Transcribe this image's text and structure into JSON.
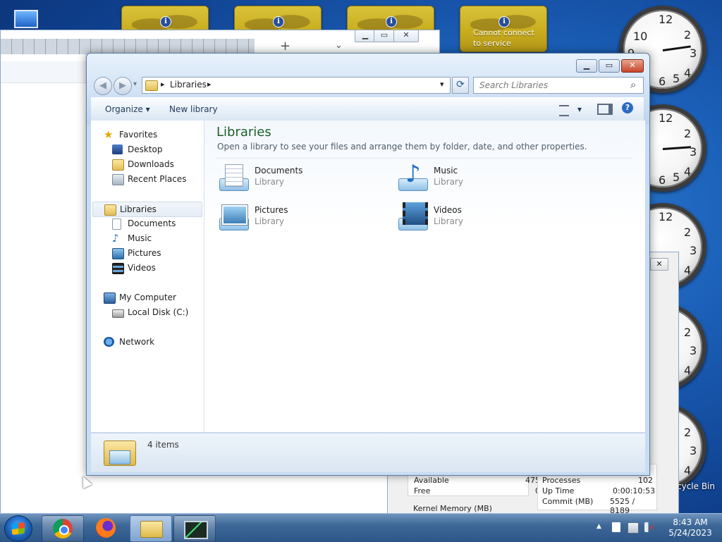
{
  "desktop": {
    "weather_gadgets": [
      {
        "message": ""
      },
      {
        "message": ""
      },
      {
        "message": ""
      },
      {
        "message": "Cannot connect to service"
      }
    ],
    "recycle_bin_label": "cycle Bin",
    "clock_numbers": [
      "12",
      "2",
      "3",
      "4",
      "5",
      "6",
      "9",
      "10"
    ]
  },
  "background_window": {
    "new_tab_symbol": "+",
    "tab_menu_symbol": "⌄"
  },
  "task_manager": {
    "close_symbol": "✕",
    "physical_memory": {
      "available_label": "Available",
      "available_value": "475",
      "free_label": "Free",
      "free_value": "0"
    },
    "kernel_memory_label": "Kernel Memory (MB)",
    "system": {
      "processes_label": "Processes",
      "processes_value": "102",
      "uptime_label": "Up Time",
      "uptime_value": "0:00:10:53",
      "commit_label": "Commit (MB)",
      "commit_value": "5525 / 8189"
    }
  },
  "explorer": {
    "caption_buttons": {
      "minimize": "▁",
      "maximize": "▭",
      "close": "✕"
    },
    "nav": {
      "back": "◀",
      "forward": "▶",
      "dropdown": "▾"
    },
    "address": {
      "crumb": "Libraries",
      "separator": "▸",
      "dropdown": "▾",
      "refresh": "⟳"
    },
    "search": {
      "placeholder": "Search Libraries",
      "icon": "⌕"
    },
    "toolbar": {
      "organize": "Organize ▾",
      "new_library": "New library",
      "views_arrow": "▾",
      "help": "?"
    },
    "navpane": {
      "favorites": {
        "label": "Favorites",
        "items": [
          "Desktop",
          "Downloads",
          "Recent Places"
        ]
      },
      "libraries": {
        "label": "Libraries",
        "items": [
          "Documents",
          "Music",
          "Pictures",
          "Videos"
        ]
      },
      "computer": {
        "label": "My Computer",
        "items": [
          "Local Disk (C:)"
        ]
      },
      "network": {
        "label": "Network"
      }
    },
    "content": {
      "title": "Libraries",
      "subtitle": "Open a library to see your files and arrange them by folder, date, and other properties.",
      "libraries": [
        {
          "name": "Documents",
          "type": "Library",
          "icon": "documents-library-icon"
        },
        {
          "name": "Music",
          "type": "Library",
          "icon": "music-library-icon"
        },
        {
          "name": "Pictures",
          "type": "Library",
          "icon": "pictures-library-icon"
        },
        {
          "name": "Videos",
          "type": "Library",
          "icon": "videos-library-icon"
        }
      ]
    },
    "details": {
      "count": "4 items"
    }
  },
  "taskbar": {
    "apps": [
      "Google Chrome",
      "Firefox",
      "Windows Explorer",
      "Task Manager"
    ],
    "clock": {
      "time": "8:43 AM",
      "date": "5/24/2023"
    },
    "tray_arrow": "▲",
    "colors": {
      "accent": "#1e5e2a",
      "taskbar": "#3e6898"
    }
  }
}
